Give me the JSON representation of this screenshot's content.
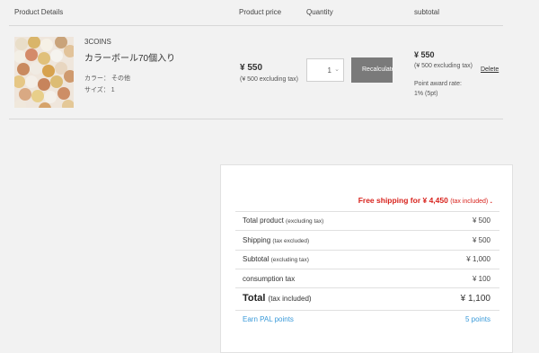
{
  "table_header": {
    "product_details": "Product Details",
    "product_price": "Product price",
    "quantity": "Quantity",
    "subtotal": "subtotal"
  },
  "item": {
    "brand": "3COINS",
    "name": "カラーボール70個入り",
    "color_option": "カラー： その他",
    "size_option": "サイズ： 1",
    "price": "¥ 550",
    "price_excl": "(¥ 500 excluding tax)",
    "quantity": "1",
    "recalculate_label": "Recalculate",
    "subtotal": "¥ 550",
    "subtotal_excl": "(¥ 500 excluding tax)",
    "delete_label": "Delete",
    "award_label": "Point award rate:",
    "award_value": "1% (5pt)"
  },
  "summary": {
    "free_shipping_text": "Free shipping for ¥ 4,450",
    "free_shipping_note": "(tax included)",
    "free_shipping_end": ".",
    "rows": [
      {
        "label": "Total product",
        "note": "(excluding tax)",
        "value": "¥ 500"
      },
      {
        "label": "Shipping",
        "note": "(tax excluded)",
        "value": "¥ 500"
      },
      {
        "label": "Subtotal",
        "note": "(excluding tax)",
        "value": "¥ 1,000"
      },
      {
        "label": "consumption tax",
        "note": "",
        "value": "¥ 100"
      }
    ],
    "total_label": "Total",
    "total_note": "(tax included)",
    "total_value": "¥ 1,100",
    "pal_label": "Earn PAL points",
    "pal_value": "5 points"
  },
  "colors": {
    "free_shipping": "#d8231d",
    "link_blue": "#3a9ad9",
    "button_gray": "#7a7a7a",
    "page_bg": "#f2f2f2"
  },
  "icons": {
    "quantity_dropdown": "chevron-down-icon"
  }
}
